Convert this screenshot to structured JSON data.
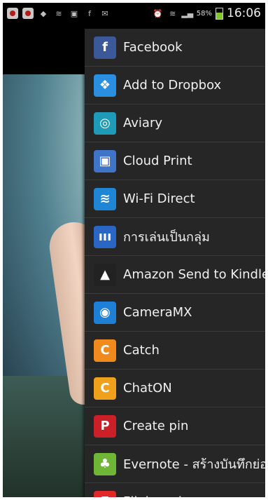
{
  "status_bar": {
    "battery_percent": "58%",
    "time": "16:06"
  },
  "share_menu": {
    "items": [
      {
        "label": "Facebook",
        "icon": "facebook-icon",
        "color": "#3b5998",
        "glyph": "f"
      },
      {
        "label": "Add to Dropbox",
        "icon": "dropbox-icon",
        "color": "#2a8fe0",
        "glyph": "❖"
      },
      {
        "label": "Aviary",
        "icon": "aviary-icon",
        "color": "#1d9bb8",
        "glyph": "◎"
      },
      {
        "label": "Cloud Print",
        "icon": "cloud-print-icon",
        "color": "#3f74c9",
        "glyph": "▣"
      },
      {
        "label": "Wi-Fi Direct",
        "icon": "wifi-direct-icon",
        "color": "#1f86d6",
        "glyph": "≋"
      },
      {
        "label": "การเล่นเป็นกลุ่ม",
        "icon": "group-play-icon",
        "color": "#2a66c4",
        "glyph": "ııı"
      },
      {
        "label": "Amazon Send to Kindle",
        "icon": "kindle-icon",
        "color": "#222222",
        "glyph": "▲"
      },
      {
        "label": "CameraMX",
        "icon": "cameramx-icon",
        "color": "#1d7fd6",
        "glyph": "◉"
      },
      {
        "label": "Catch",
        "icon": "catch-icon",
        "color": "#f08a1c",
        "glyph": "C"
      },
      {
        "label": "ChatON",
        "icon": "chaton-icon",
        "color": "#f0a11c",
        "glyph": "C"
      },
      {
        "label": "Create pin",
        "icon": "pinterest-icon",
        "color": "#cb2027",
        "glyph": "P"
      },
      {
        "label": "Evernote - สร้างบันทึกย่อ",
        "icon": "evernote-icon",
        "color": "#6fb536",
        "glyph": "♣"
      },
      {
        "label": "Flipboard",
        "icon": "flipboard-icon",
        "color": "#e12828",
        "glyph": "F"
      }
    ]
  }
}
